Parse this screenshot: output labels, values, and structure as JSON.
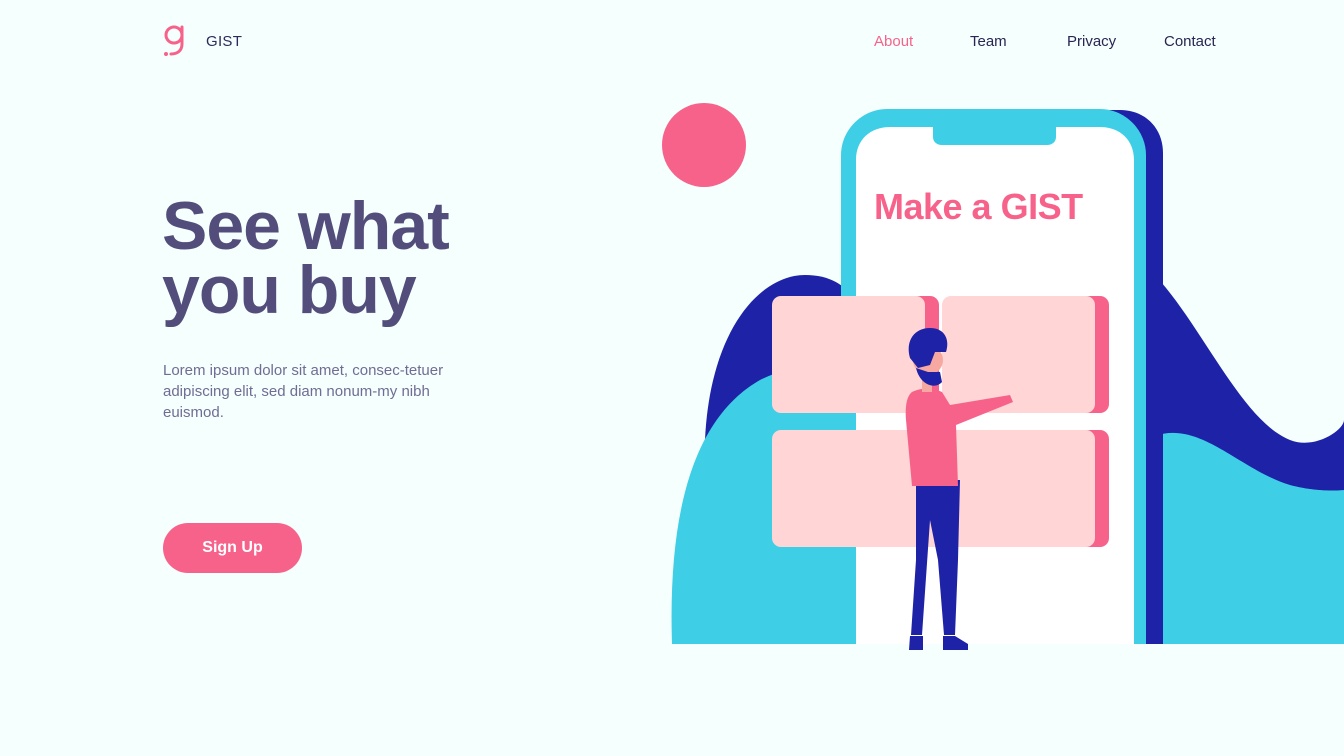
{
  "header": {
    "brand": "GIST",
    "nav": [
      {
        "label": "About",
        "active": true
      },
      {
        "label": "Team",
        "active": false
      },
      {
        "label": "Privacy",
        "active": false
      },
      {
        "label": "Contact",
        "active": false
      }
    ]
  },
  "hero": {
    "title_line1": "See what",
    "title_line2": "you buy",
    "body": "Lorem ipsum dolor sit amet, consec-tetuer adipiscing elit, sed diam nonum-my nibh euismod.",
    "cta_label": "Sign Up"
  },
  "illustration": {
    "phone_title": "Make a GIST"
  },
  "colors": {
    "accent": "#f7628a",
    "heading": "#534d7b",
    "navy": "#1e22a6",
    "cyan": "#3ecfe6",
    "card": "#ffd5d5",
    "background": "#f5fffd"
  }
}
